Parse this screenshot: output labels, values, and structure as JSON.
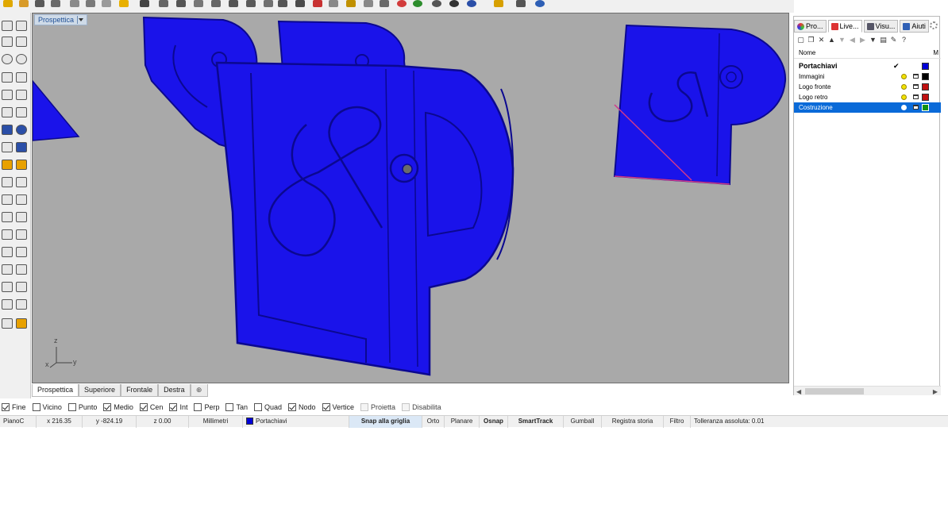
{
  "viewport": {
    "title": "Prospettica",
    "axis_z": "z",
    "axis_x": "x",
    "axis_y": "y",
    "model_color": "#1a13ea"
  },
  "viewport_tabs": [
    "Prospettica",
    "Superiore",
    "Frontale",
    "Destra"
  ],
  "osnaps": [
    {
      "label": "Fine",
      "checked": true
    },
    {
      "label": "Vicino",
      "checked": false
    },
    {
      "label": "Punto",
      "checked": false
    },
    {
      "label": "Medio",
      "checked": true
    },
    {
      "label": "Cen",
      "checked": true
    },
    {
      "label": "Int",
      "checked": true
    },
    {
      "label": "Perp",
      "checked": false
    },
    {
      "label": "Tan",
      "checked": false
    },
    {
      "label": "Quad",
      "checked": false
    },
    {
      "label": "Nodo",
      "checked": true
    },
    {
      "label": "Vertice",
      "checked": true
    },
    {
      "label": "Proietta",
      "checked": false
    },
    {
      "label": "Disabilita",
      "checked": false
    }
  ],
  "status_bar": {
    "cplane": "PianoC",
    "x": "x 216.35",
    "y": "y -824.19",
    "z": "z 0.00",
    "units": "Millimetri",
    "layer": "Portachiavi",
    "layer_color": "#0000d8",
    "buttons": [
      "Snap alla griglia",
      "Orto",
      "Planare",
      "Osnap",
      "SmartTrack",
      "Gumball",
      "Registra storia",
      "Filtro"
    ],
    "tolerance": "Tolleranza assoluta: 0.01"
  },
  "panel": {
    "tabs": [
      "Pro...",
      "Live...",
      "Visu...",
      "Aiuti"
    ],
    "col_name": "Nome",
    "col_material": "M",
    "layers": [
      {
        "name": "Portachiavi",
        "current": true,
        "color": "#0000d8",
        "parent": true,
        "selected": false
      },
      {
        "name": "Immagini",
        "current": false,
        "color": "#000000",
        "parent": false,
        "selected": false
      },
      {
        "name": "Logo fronte",
        "current": false,
        "color": "#c01010",
        "parent": false,
        "selected": false
      },
      {
        "name": "Logo retro",
        "current": false,
        "color": "#c01010",
        "parent": false,
        "selected": false
      },
      {
        "name": "Costruzione",
        "current": false,
        "color": "#109010",
        "parent": false,
        "selected": true
      }
    ]
  }
}
